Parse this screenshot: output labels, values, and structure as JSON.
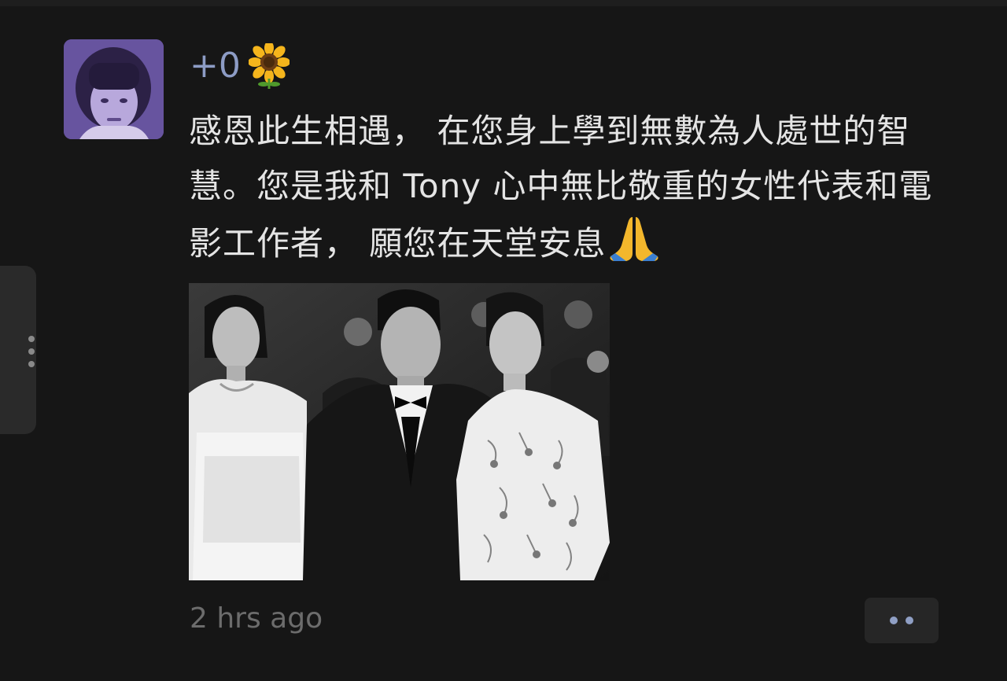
{
  "post": {
    "nickname": "+0",
    "nickname_icon": "sunflower-icon",
    "text": "感恩此生相遇， 在您身上學到無數為人處世的智慧。您是我和 Tony 心中無比敬重的女性代表和電影工作者， 願您在天堂安息",
    "text_end_icon": "pray-icon",
    "timestamp": "2 hrs ago"
  },
  "colors": {
    "background": "#161616",
    "nickname": "#8d9cc5",
    "text": "#e4e4e4",
    "timestamp": "#6c6c6c",
    "more_dots": "#8f9fc4"
  },
  "icons": {
    "side_handle": "vertical-dots-icon",
    "more_button": "horizontal-dots-icon"
  }
}
